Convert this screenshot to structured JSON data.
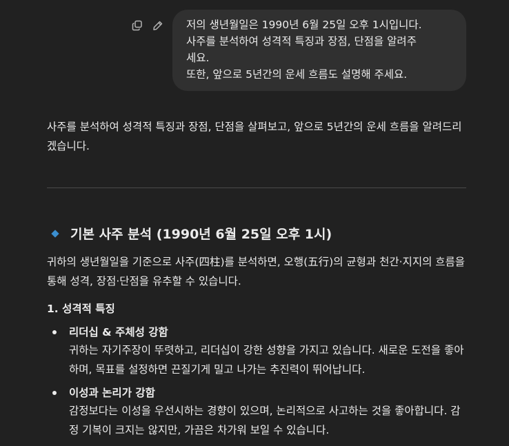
{
  "user_message": {
    "lines": [
      "저의 생년월일은 1990년 6월 25일 오후 1시입니다.",
      "사주를 분석하여 성격적 특징과 장점, 단점을 알려주",
      "세요.",
      "또한, 앞으로 5년간의 운세 흐름도 설명해 주세요."
    ],
    "actions": {
      "copy_icon": "copy-icon",
      "edit_icon": "pencil-icon"
    }
  },
  "assistant": {
    "intro": "사주를 분석하여 성격적 특징과 장점, 단점을 살펴보고, 앞으로 5년간의 운세 흐름을 알려드리겠습니다.",
    "section_title": "기본 사주 분석 (1990년 6월 25일 오후 1시)",
    "section_paragraph": "귀하의 생년월일을 기준으로 사주(四柱)를 분석하면, 오행(五行)의 균형과 천간·지지의 흐름을 통해 성격, 장점·단점을 유추할 수 있습니다.",
    "subheading": "1. 성격적 특징",
    "bullets": [
      {
        "title": "리더십 & 주체성 강함",
        "text": "귀하는 자기주장이 뚜렷하고, 리더십이 강한 성향을 가지고 있습니다. 새로운 도전을 좋아하며, 목표를 설정하면 끈질기게 밀고 나가는 추진력이 뛰어납니다."
      },
      {
        "title": "이성과 논리가 강함",
        "text": "감정보다는 이성을 우선시하는 경향이 있으며, 논리적으로 사고하는 것을 좋아합니다. 감정 기복이 크지는 않지만, 가끔은 차가워 보일 수 있습니다."
      }
    ]
  },
  "colors": {
    "background": "#212121",
    "bubble": "#303030",
    "text": "#ececec",
    "accent_diamond": "#3b8fd0"
  }
}
